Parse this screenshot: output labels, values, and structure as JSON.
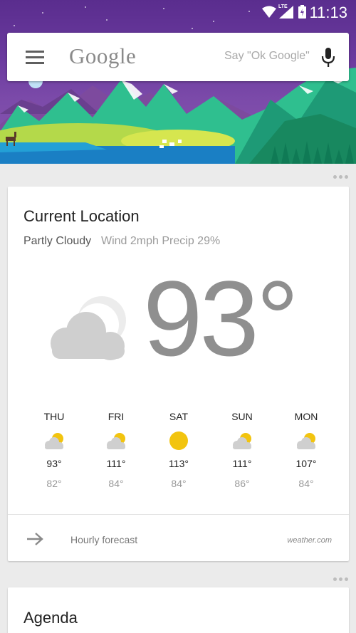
{
  "status": {
    "time": "11:13",
    "network": "LTE"
  },
  "search": {
    "logo": "Google",
    "hint": "Say \"Ok Google\""
  },
  "weather": {
    "title": "Current Location",
    "condition": "Partly Cloudy",
    "details": "Wind 2mph Precip 29%",
    "temperature": "93°",
    "forecast": [
      {
        "day": "THU",
        "high": "93°",
        "low": "82°",
        "icon": "partly-cloudy-icon"
      },
      {
        "day": "FRI",
        "high": "111°",
        "low": "84°",
        "icon": "partly-cloudy-icon"
      },
      {
        "day": "SAT",
        "high": "113°",
        "low": "84°",
        "icon": "sunny-icon"
      },
      {
        "day": "SUN",
        "high": "111°",
        "low": "86°",
        "icon": "partly-cloudy-icon"
      },
      {
        "day": "MON",
        "high": "107°",
        "low": "84°",
        "icon": "partly-cloudy-icon"
      }
    ],
    "hourly_label": "Hourly forecast",
    "source": "weather.com"
  },
  "agenda": {
    "title": "Agenda"
  },
  "colors": {
    "sun": "#f2c40f",
    "cloud": "#cfcfcf",
    "hero_sky": "#5a2d8e",
    "mountain": "#2fc28f"
  }
}
